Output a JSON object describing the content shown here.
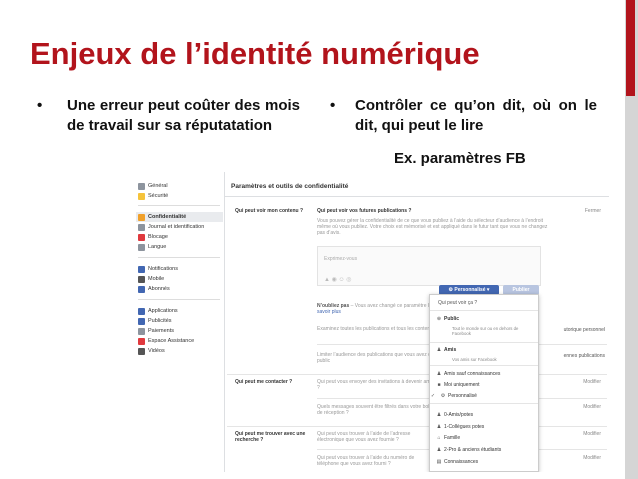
{
  "slide": {
    "title": "Enjeux de l’identité numérique",
    "bullet_symbol": "•",
    "bullets": [
      "Une erreur peut coûter des mois de travail sur sa réputatation",
      "Contrôler ce qu’on dit, où on le dit, qui peut le lire"
    ],
    "example_label": "Ex. paramètres FB",
    "colors": {
      "title": "#b2141c",
      "accent_bar": "#b2141c"
    }
  },
  "fb": {
    "nav": {
      "group1": [
        {
          "label": "Général",
          "icon": "gear-icon",
          "color": "#8d949e"
        },
        {
          "label": "Sécurité",
          "icon": "shield-icon",
          "color": "#f5c33b"
        }
      ],
      "group2": [
        {
          "label": "Confidentialité",
          "icon": "lock-icon",
          "color": "#f0a02a",
          "active": true
        },
        {
          "label": "Journal et identification",
          "icon": "journal-icon",
          "color": "#8d949e"
        },
        {
          "label": "Blocage",
          "icon": "block-icon",
          "color": "#e0393e"
        },
        {
          "label": "Langue",
          "icon": "globe-icon",
          "color": "#8d949e"
        }
      ],
      "group3": [
        {
          "label": "Notifications",
          "icon": "globe-icon",
          "color": "#4267b2"
        },
        {
          "label": "Mobile",
          "icon": "mobile-icon",
          "color": "#555555"
        },
        {
          "label": "Abonnés",
          "icon": "rss-icon",
          "color": "#4267b2"
        }
      ],
      "group4": [
        {
          "label": "Applications",
          "icon": "apps-icon",
          "color": "#4267b2"
        },
        {
          "label": "Publicités",
          "icon": "ads-icon",
          "color": "#4267b2"
        },
        {
          "label": "Paiements",
          "icon": "card-icon",
          "color": "#8d949e"
        },
        {
          "label": "Espace Assistance",
          "icon": "lifebuoy-icon",
          "color": "#e0393e"
        },
        {
          "label": "Vidéos",
          "icon": "video-icon",
          "color": "#555555"
        }
      ]
    },
    "header": "Paramètres et outils de confidentialité",
    "section1": {
      "label": "Qui peut voir mon contenu ?",
      "question": "Qui peut voir vos futures publications ?",
      "close": "Fermer",
      "desc": "Vous pouvez gérer la confidentialité de ce que vous publiez à l’aide du sélecteur d’audience à l’endroit même où vous publiez. Votre choix est mémorisé et est appliqué dans le futur tant que vous ne changez pas d’avis.",
      "composer_placeholder": "Exprimez-vous",
      "composer_icons": "▲  ◉  ☺  ◎",
      "note_bold": "N’oubliez pas",
      "note": " – Vous avez changé ce paramètre lors de votre dernière publication.",
      "note_link": "En savoir plus",
      "perso_button": "⚙ Personnalisé ▾",
      "publish_button": "Publier",
      "review": "Examinez toutes les publications et tous les contenus dans lesquels vous êtes identifié(e)",
      "review_side": "utorique personnel",
      "limit": "Limiter l’audience des publications que vous avez ouvertes aux amis de vos amis ou au public",
      "limit_side": "ennes publications"
    },
    "section2": {
      "label": "Qui peut me contacter ?",
      "q1": "Qui peut vous envoyer des invitations à devenir amis ?",
      "q2": "Quels messages souvent être filtrés dans votre boîte de réception ?",
      "modify": "Modifier"
    },
    "section3": {
      "label": "Qui peut me trouver avec une recherche ?",
      "q1": "Qui peut vous trouver à l’aide de l’adresse électronique que vous avez fournie ?",
      "q2": "Qui peut vous trouver à l’aide du numéro de téléphone que vous avez fourni ?",
      "modify": "Modifier"
    },
    "dropdown": {
      "header": "Qui peut voir ça ?",
      "public": "Public",
      "public_sub": "Tout le monde sur ou en dehors de Facebook",
      "friends": "Amis",
      "friends_sub": "Vos amis sur Facebook",
      "friends_except": "Amis sauf connaissances",
      "only_me": "Moi uniquement",
      "custom": "Personnalisé",
      "lists": [
        "0-Amis/potes",
        "1-Collègues potes",
        "Famille",
        "2-Pro & anciens étudiants",
        "Connaissances"
      ]
    }
  }
}
